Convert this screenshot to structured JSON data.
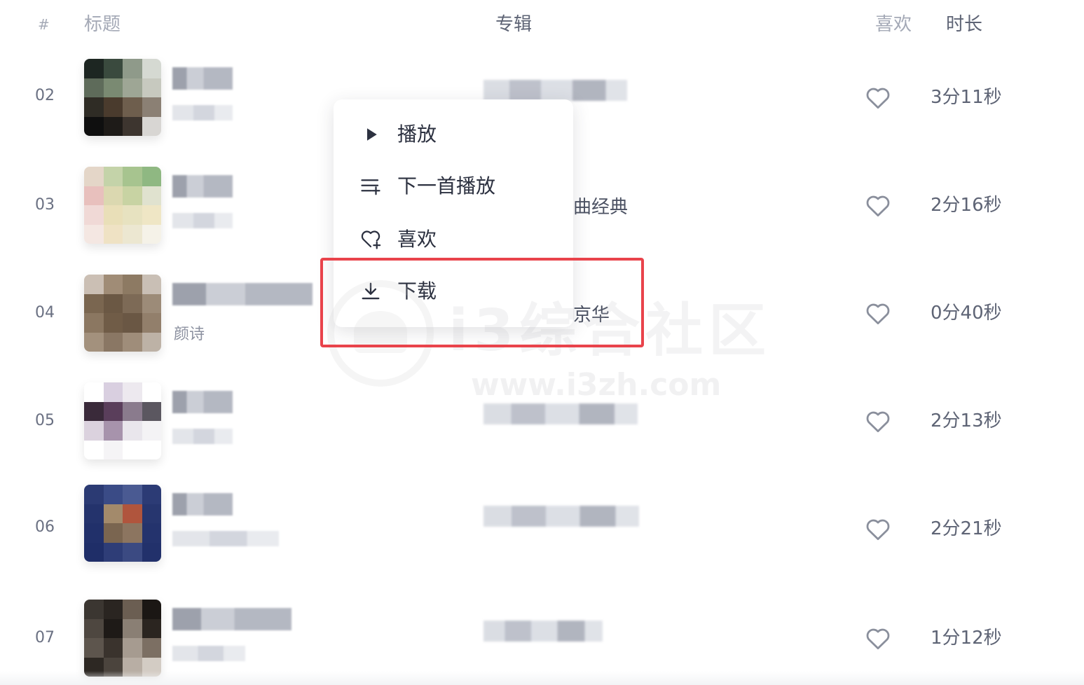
{
  "header": {
    "num": "#",
    "title": "标题",
    "album": "专辑",
    "like": "喜欢",
    "duration": "时长"
  },
  "rows": [
    {
      "num": "02",
      "subtitle": "",
      "album": "",
      "duration": "3分11秒",
      "liked": false
    },
    {
      "num": "03",
      "subtitle": "",
      "album": "曲经典",
      "duration": "2分16秒",
      "liked": false
    },
    {
      "num": "04",
      "subtitle": "颜诗",
      "album": "京华",
      "duration": "0分40秒",
      "liked": false
    },
    {
      "num": "05",
      "subtitle": "",
      "album": "",
      "duration": "2分13秒",
      "liked": false
    },
    {
      "num": "06",
      "subtitle": "",
      "album": "",
      "duration": "2分21秒",
      "liked": false
    },
    {
      "num": "07",
      "subtitle": "",
      "album": "",
      "duration": "1分12秒",
      "liked": false
    }
  ],
  "context_menu": {
    "items": [
      {
        "label": "播放",
        "icon": "play-icon"
      },
      {
        "label": "下一首播放",
        "icon": "play-next-icon"
      },
      {
        "label": "喜欢",
        "icon": "heart-add-icon"
      },
      {
        "label": "下载",
        "icon": "download-icon"
      }
    ],
    "highlighted": "下载"
  },
  "watermark": {
    "text": "i3综合社区",
    "url": "www.i3zh.com"
  },
  "colors": {
    "highlight_border": "#e9434b",
    "text_primary": "#2c3140",
    "text_muted": "#a4a9b6"
  }
}
